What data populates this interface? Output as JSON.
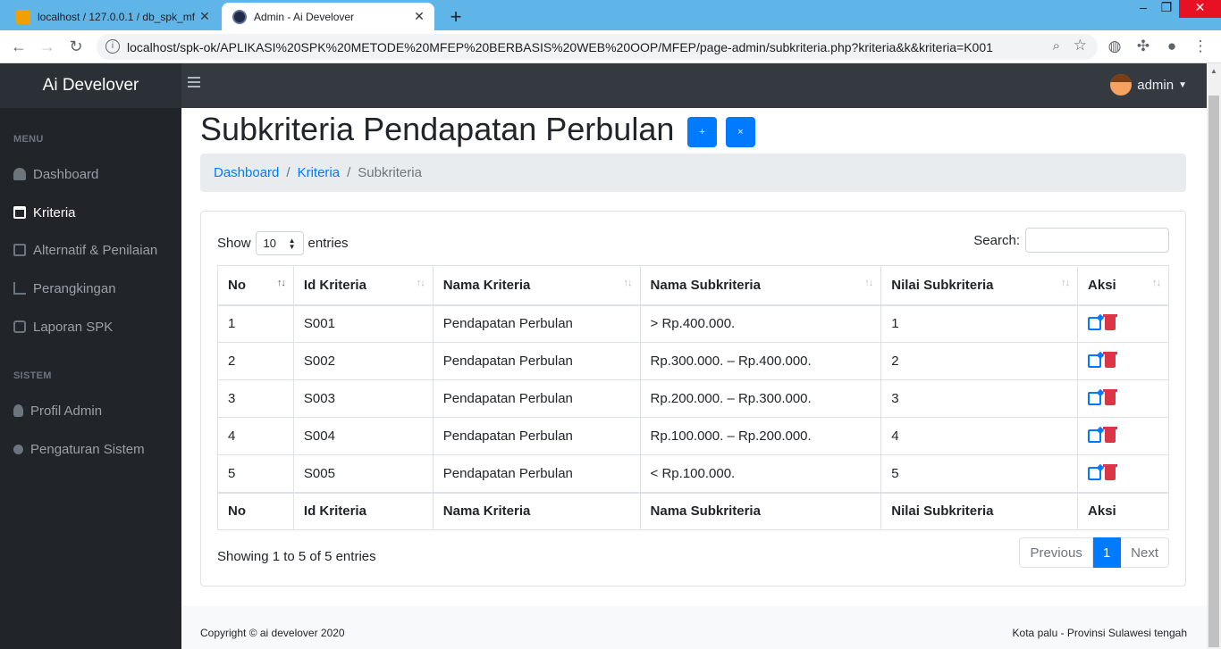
{
  "browser": {
    "tabs": [
      {
        "title": "localhost / 127.0.0.1 / db_spk_mf",
        "active": false
      },
      {
        "title": "Admin - Ai Develover",
        "active": true
      }
    ],
    "url": "localhost/spk-ok/APLIKASI%20SPK%20METODE%20MFEP%20BERBASIS%20WEB%20OOP/MFEP/page-admin/subkriteria.php?kriteria&k&kriteria=K001"
  },
  "navbar": {
    "brand": "Ai Develover",
    "user": "admin"
  },
  "sidebar": {
    "menu_heading": "MENU",
    "system_heading": "SISTEM",
    "items": [
      {
        "label": "Dashboard",
        "icon": "dashboard-icon"
      },
      {
        "label": "Kriteria",
        "icon": "calendar-icon",
        "active": true
      },
      {
        "label": "Alternatif & Penilaian",
        "icon": "table-icon"
      },
      {
        "label": "Perangkingan",
        "icon": "chart-icon"
      },
      {
        "label": "Laporan SPK",
        "icon": "print-icon"
      }
    ],
    "system_items": [
      {
        "label": "Profil Admin",
        "icon": "user-icon"
      },
      {
        "label": "Pengaturan Sistem",
        "icon": "gear-icon"
      }
    ]
  },
  "page": {
    "title": "Subkriteria Pendapatan Perbulan",
    "add_label": "+",
    "close_label": "×",
    "breadcrumb": [
      "Dashboard",
      "Kriteria",
      "Subkriteria"
    ]
  },
  "table_controls": {
    "show_label": "Show",
    "entries_label": "entries",
    "page_length": "10",
    "search_label": "Search:",
    "search_value": ""
  },
  "table": {
    "headers": [
      "No",
      "Id Kriteria",
      "Nama Kriteria",
      "Nama Subkriteria",
      "Nilai Subkriteria",
      "Aksi"
    ],
    "rows": [
      [
        "1",
        "S001",
        "Pendapatan Perbulan",
        "> Rp.400.000.",
        "1"
      ],
      [
        "2",
        "S002",
        "Pendapatan Perbulan",
        "Rp.300.000. – Rp.400.000.",
        "2"
      ],
      [
        "3",
        "S003",
        "Pendapatan Perbulan",
        "Rp.200.000. – Rp.300.000.",
        "3"
      ],
      [
        "4",
        "S004",
        "Pendapatan Perbulan",
        "Rp.100.000. – Rp.200.000.",
        "4"
      ],
      [
        "5",
        "S005",
        "Pendapatan Perbulan",
        "< Rp.100.000.",
        "5"
      ]
    ]
  },
  "pagination": {
    "info": "Showing 1 to 5 of 5 entries",
    "previous": "Previous",
    "current": "1",
    "next": "Next"
  },
  "footer": {
    "copyright": "Copyright © ai develover 2020",
    "location": "Kota palu - Provinsi Sulawesi tengah"
  },
  "colors": {
    "primary": "#007bff",
    "danger": "#dc3545",
    "sidebar_bg": "#212529",
    "navbar_bg": "#343a40"
  }
}
